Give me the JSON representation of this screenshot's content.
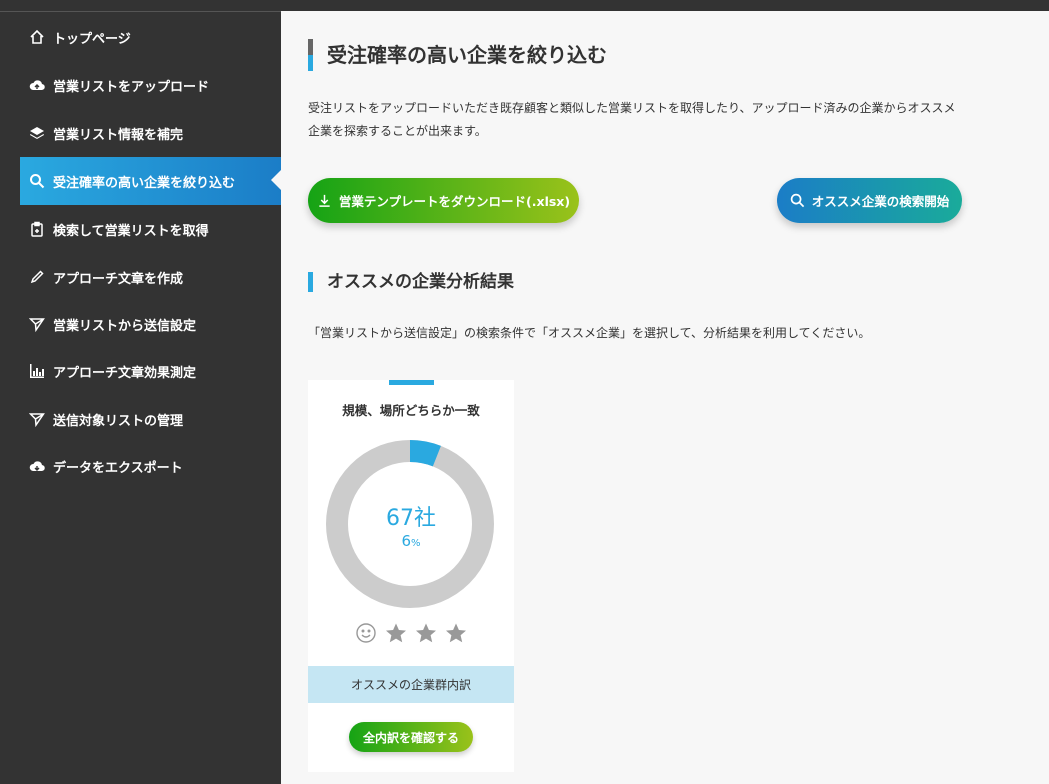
{
  "sidebar": {
    "items": [
      {
        "label": "トップページ",
        "icon": "home-icon"
      },
      {
        "label": "営業リストをアップロード",
        "icon": "cloud-upload-icon"
      },
      {
        "label": "営業リスト情報を補完",
        "icon": "layers-icon"
      },
      {
        "label": "受注確率の高い企業を絞り込む",
        "icon": "search-icon"
      },
      {
        "label": "検索して営業リストを取得",
        "icon": "clipboard-icon"
      },
      {
        "label": "アプローチ文章を作成",
        "icon": "pencil-icon"
      },
      {
        "label": "営業リストから送信設定",
        "icon": "send-icon"
      },
      {
        "label": "アプローチ文章効果測定",
        "icon": "bar-chart-icon"
      },
      {
        "label": "送信対象リストの管理",
        "icon": "send-icon"
      },
      {
        "label": "データをエクスポート",
        "icon": "cloud-download-icon"
      }
    ],
    "active_index": 3
  },
  "main": {
    "title": "受注確率の高い企業を絞り込む",
    "description": "受注リストをアップロードいただき既存顧客と類似した営業リストを取得したり、アップロード済みの企業からオススメ企業を探索することが出来ます。",
    "download_button": "営業テンプレートをダウンロード(.xlsx)",
    "search_button": "オススメ企業の検索開始",
    "results_title": "オススメの企業分析結果",
    "results_description": "「営業リストから送信設定」の検索条件で「オススメ企業」を選択して、分析結果を利用してください。",
    "card": {
      "title": "規模、場所どちらか一致",
      "count": "67社",
      "percent": "6",
      "percent_unit": "%",
      "percent_value": 6,
      "rating_stars": 3,
      "breakdown_label": "オススメの企業群内訳",
      "confirm_button": "全内訳を確認する"
    }
  },
  "colors": {
    "accent_blue": "#2aa9e0",
    "sidebar_bg": "#333333",
    "donut_track": "#cccccc"
  }
}
